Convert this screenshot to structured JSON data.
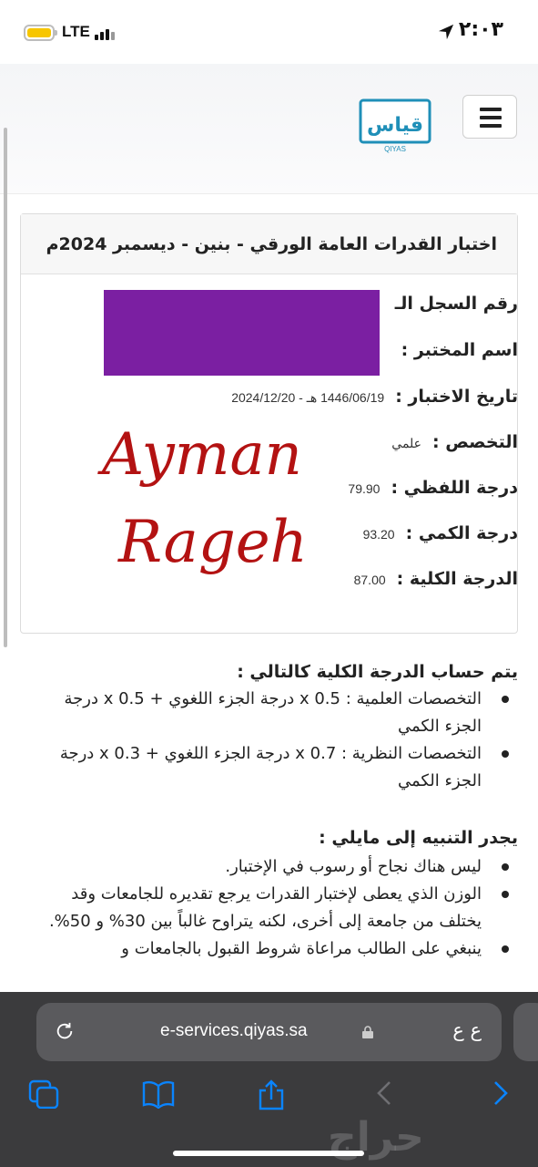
{
  "status_bar": {
    "carrier": "LTE",
    "time": "٢:٠٣",
    "battery_color": "#f7c600"
  },
  "header": {
    "logo_caption": "QIYAS",
    "logo_mark": "قياس",
    "menu_icon": "hamburger-icon"
  },
  "result_card": {
    "title": "اختبار القدرات العامة الورقي - بنين - ديسمبر 2024م",
    "rows": [
      {
        "label": "رقم السجل الـ",
        "value": ""
      },
      {
        "label": "اسم المختبر :",
        "value": ""
      },
      {
        "label": "تاريخ الاختبار :",
        "value": "1446/06/19 هـ - 2024/12/20"
      },
      {
        "label": "التخصص :",
        "value": "علمي"
      },
      {
        "label": "درجة اللفظي :",
        "value": "79.90"
      },
      {
        "label": "درجة الكمي :",
        "value": "93.20"
      },
      {
        "label": "الدرجة الكلية :",
        "value": "87.00"
      }
    ],
    "signature_line1": "Ayman",
    "signature_line2": "Rageh",
    "redaction_color": "#7b1fa2"
  },
  "calc_section": {
    "title": "يتم حساب الدرجة الكلية كالتالي :",
    "items": [
      "التخصصات العلمية : 0.5 x درجة الجزء اللغوي + 0.5 x درجة الجزء الكمي",
      "التخصصات النظرية : 0.7 x درجة الجزء اللغوي + 0.3 x درجة الجزء الكمي"
    ]
  },
  "notice_section": {
    "title": "يجدر التنبيه إلى مايلي :",
    "items": [
      "ليس هناك نجاح أو رسوب في الإختبار.",
      "الوزن الذي يعطى لإختبار القدرات يرجع تقديره للجامعات وقد يختلف من جامعة إلى أخرى، لكنه يتراوح غالباً بين 30% و 50%.",
      "ينبغي على الطالب مراعاة شروط القبول بالجامعات و"
    ]
  },
  "browser": {
    "url": "e-services.qiyas.sa",
    "text_size_label": "ع ع",
    "accent": "#0a84ff"
  },
  "watermark": "حراج"
}
